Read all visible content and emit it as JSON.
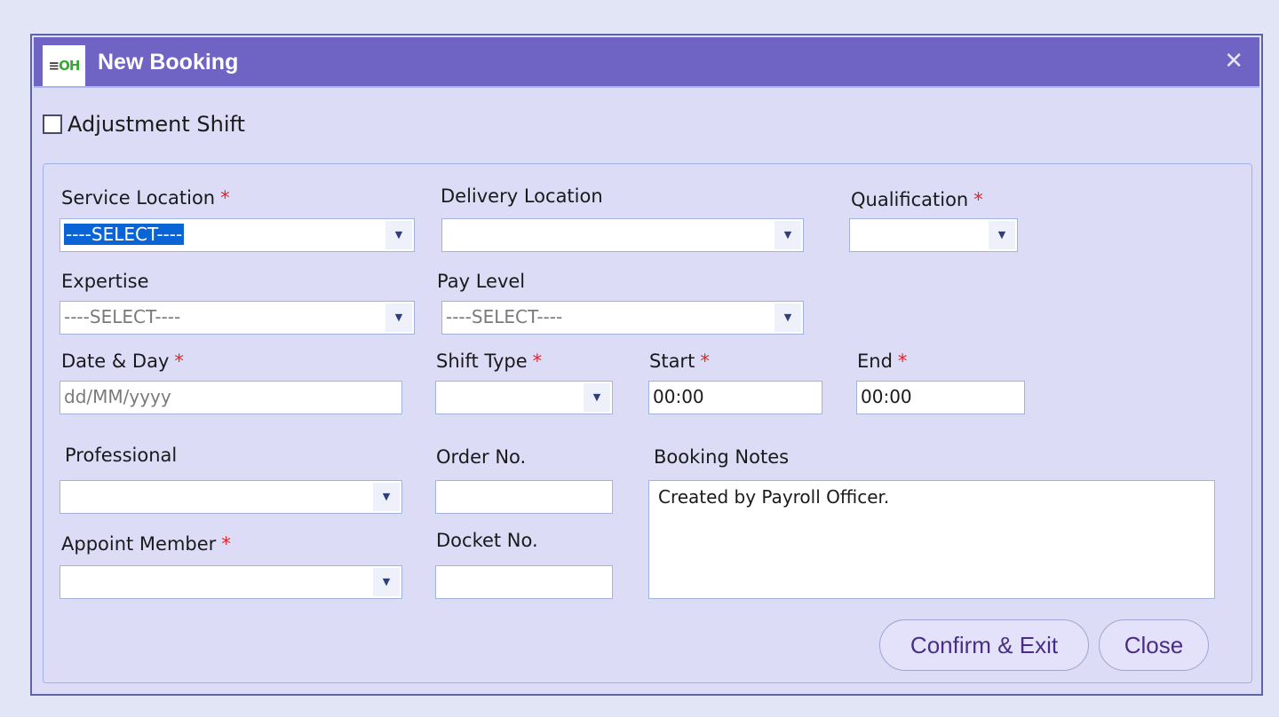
{
  "dialog": {
    "title": "New Booking",
    "logo_bars": "≡",
    "logo_text": "OH",
    "close_glyph": "✕"
  },
  "adjustment": {
    "label": "Adjustment Shift",
    "checked": false
  },
  "form": {
    "service_location": {
      "label": "Service Location",
      "required": "*",
      "value": "----SELECT----"
    },
    "delivery_location": {
      "label": "Delivery Location",
      "value": ""
    },
    "qualification": {
      "label": "Qualification",
      "required": "*",
      "value": ""
    },
    "expertise": {
      "label": "Expertise",
      "value": "----SELECT----"
    },
    "pay_level": {
      "label": "Pay Level",
      "value": "----SELECT----"
    },
    "date_day": {
      "label": "Date & Day",
      "required": "*",
      "placeholder": "dd/MM/yyyy"
    },
    "shift_type": {
      "label": "Shift Type",
      "required": "*",
      "value": ""
    },
    "start": {
      "label": "Start",
      "required": "*",
      "value": "00:00"
    },
    "end": {
      "label": "End",
      "required": "*",
      "value": "00:00"
    },
    "professional": {
      "label": "Professional",
      "value": ""
    },
    "order_no": {
      "label": "Order No.",
      "value": ""
    },
    "booking_notes": {
      "label": "Booking Notes",
      "value": "Created by Payroll Officer."
    },
    "appoint_member": {
      "label": "Appoint Member",
      "required": "*",
      "value": ""
    },
    "docket_no": {
      "label": "Docket No.",
      "value": ""
    }
  },
  "buttons": {
    "confirm_exit": "Confirm & Exit",
    "close": "Close"
  },
  "icons": {
    "dropdown": "▼"
  }
}
